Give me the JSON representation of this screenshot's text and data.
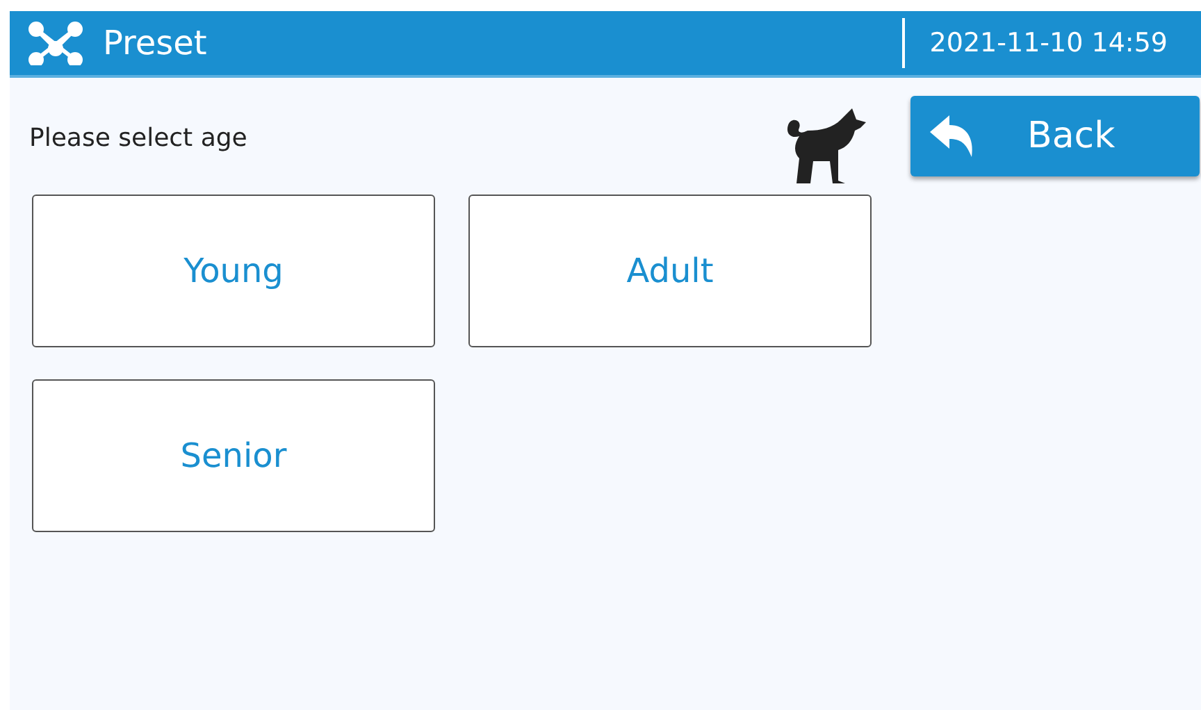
{
  "header": {
    "title": "Preset",
    "datetime": "2021-11-10 14:59"
  },
  "prompt": "Please select age",
  "back_button": {
    "label": "Back"
  },
  "options": [
    {
      "label": "Young"
    },
    {
      "label": "Adult"
    },
    {
      "label": "Senior"
    }
  ]
}
